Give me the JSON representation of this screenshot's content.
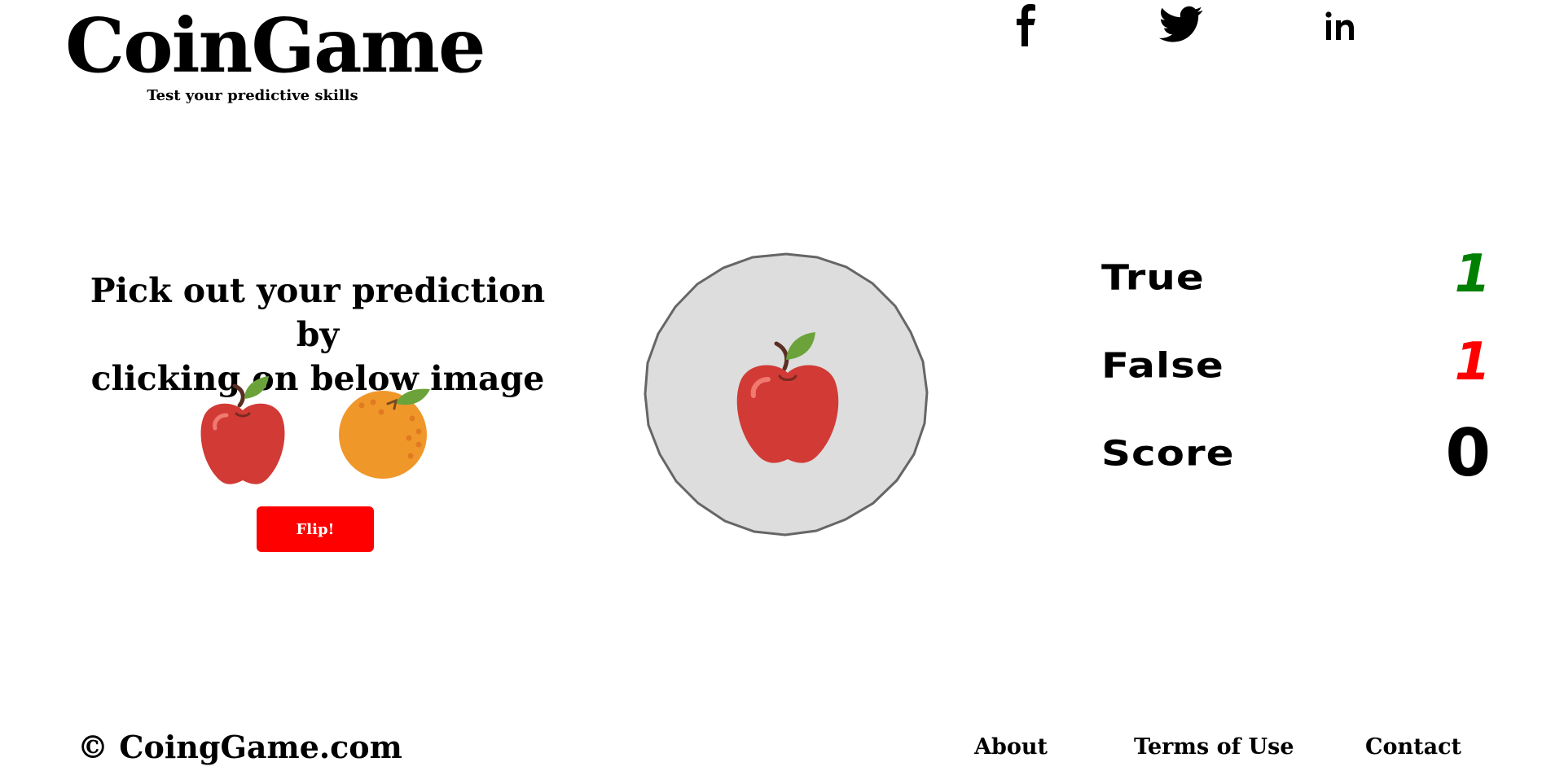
{
  "header": {
    "brand_title": "CoinGame",
    "tagline": "Test your predictive skills",
    "social": [
      {
        "name": "facebook",
        "icon": "facebook-icon"
      },
      {
        "name": "twitter",
        "icon": "twitter-icon"
      },
      {
        "name": "linkedin",
        "icon": "linkedin-icon"
      }
    ]
  },
  "game": {
    "prompt_line1": "Pick out your prediction by",
    "prompt_line2": "clicking on below image",
    "choices": [
      {
        "id": "apple",
        "icon": "apple-icon"
      },
      {
        "id": "orange",
        "icon": "orange-icon"
      }
    ],
    "flip_label": "Flip!",
    "coin_face": "apple-icon"
  },
  "scoreboard": {
    "true_label": "True",
    "true_value": "1",
    "false_label": "False",
    "false_value": "1",
    "score_label": "Score",
    "score_value": "0"
  },
  "footer": {
    "copyright": "© CoingGame.com",
    "links": {
      "about": "About",
      "terms": "Terms of Use",
      "contact": "Contact"
    }
  },
  "colors": {
    "flip_button": "#ff0000",
    "true_value": "#008000",
    "false_value": "#ff0000",
    "coin_fill": "#dddddd",
    "coin_border": "#666666"
  }
}
